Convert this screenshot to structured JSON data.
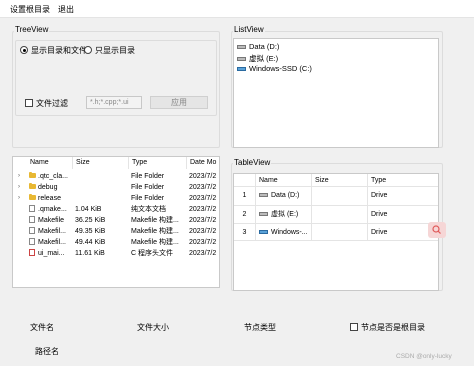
{
  "menu": {
    "items": [
      "设置根目录",
      "退出"
    ]
  },
  "treeview_group": {
    "title": "TreeView",
    "radio_show_all": "显示目录和文件",
    "radio_dirs_only": "只显示目录",
    "filter_label": "文件过滤",
    "filter_value": "*.h;*.cpp;*.ui",
    "apply_button": "应用"
  },
  "tree_table": {
    "columns": [
      "Name",
      "Size",
      "Type",
      "Date Mo"
    ],
    "rows": [
      {
        "name": ".qtc_cla...",
        "size": "",
        "type": "File Folder",
        "date": "2023/7/2",
        "icon": "folder-icon",
        "expandable": true
      },
      {
        "name": "debug",
        "size": "",
        "type": "File Folder",
        "date": "2023/7/2",
        "icon": "folder-icon",
        "expandable": true
      },
      {
        "name": "release",
        "size": "",
        "type": "File Folder",
        "date": "2023/7/2",
        "icon": "folder-icon",
        "expandable": true
      },
      {
        "name": ".qmake...",
        "size": "1.04 KiB",
        "type": "纯文本文档",
        "date": "2023/7/2",
        "icon": "file-icon",
        "expandable": false
      },
      {
        "name": "Makefile",
        "size": "36.25 KiB",
        "type": "Makefile 构建...",
        "date": "2023/7/2",
        "icon": "file-icon",
        "expandable": false
      },
      {
        "name": "Makefil...",
        "size": "49.35 KiB",
        "type": "Makefile 构建...",
        "date": "2023/7/2",
        "icon": "file-icon",
        "expandable": false
      },
      {
        "name": "Makefil...",
        "size": "49.44 KiB",
        "type": "Makefile 构建...",
        "date": "2023/7/2",
        "icon": "file-icon",
        "expandable": false
      },
      {
        "name": "ui_mai...",
        "size": "11.61 KiB",
        "type": "C 程序头文件",
        "date": "2023/7/2",
        "icon": "header-file-icon",
        "expandable": false
      }
    ]
  },
  "listview_group": {
    "title": "ListView",
    "items": [
      "Data (D:)",
      "虚拟 (E:)",
      "Windows-SSD (C:)"
    ]
  },
  "tableview_group": {
    "title": "TableView",
    "columns": [
      "Name",
      "Size",
      "Type"
    ],
    "rows": [
      {
        "num": "1",
        "name": "Data (D:)",
        "size": "",
        "type": "Drive"
      },
      {
        "num": "2",
        "name": "虚拟 (E:)",
        "size": "",
        "type": "Drive"
      },
      {
        "num": "3",
        "name": "Windows-...",
        "size": "",
        "type": "Drive"
      }
    ]
  },
  "status": {
    "file_name": "文件名",
    "file_size": "文件大小",
    "node_type": "节点类型",
    "is_dir_label": "节点是否是根目录",
    "path_name": "路径名"
  },
  "watermark": "CSDN @only-lucky"
}
